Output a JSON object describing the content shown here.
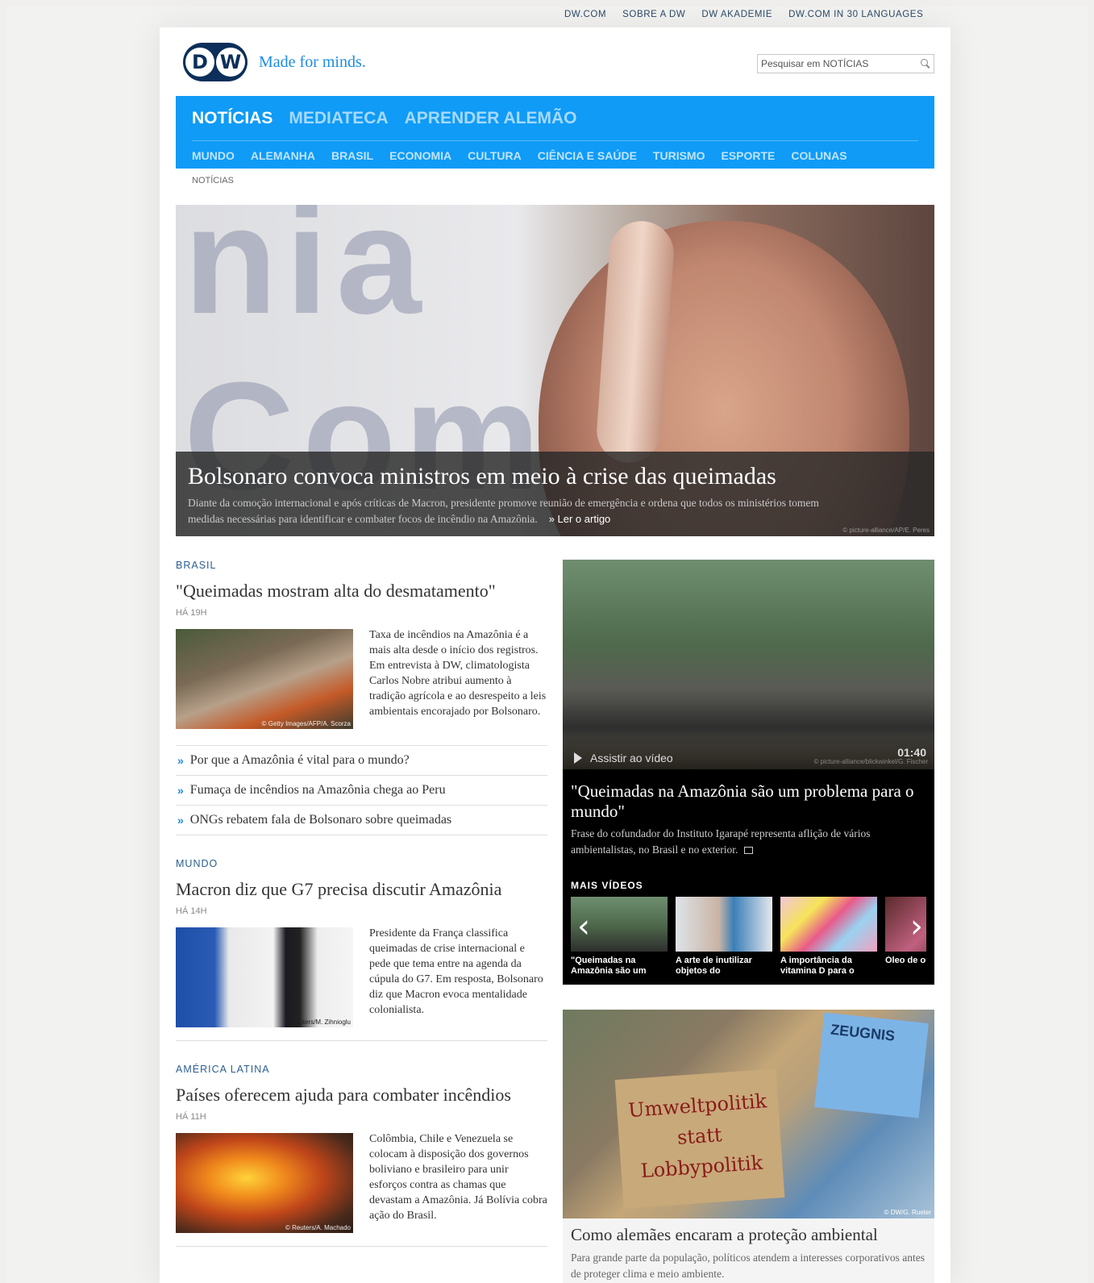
{
  "top_links": [
    "DW.COM",
    "SOBRE A DW",
    "DW AKADEMIE",
    "DW.COM IN 30 LANGUAGES"
  ],
  "brand": {
    "logo_text": "DW",
    "tagline": "Made for minds."
  },
  "search": {
    "placeholder": "Pesquisar em NOTÍCIAS"
  },
  "main_nav": [
    "NOTÍCIAS",
    "MEDIATECA",
    "APRENDER ALEMÃO"
  ],
  "sub_nav": [
    "MUNDO",
    "ALEMANHA",
    "BRASIL",
    "ECONOMIA",
    "CULTURA",
    "CIÊNCIA E SAÚDE",
    "TURISMO",
    "ESPORTE",
    "COLUNAS"
  ],
  "breadcrumb": "NOTÍCIAS",
  "hero": {
    "title": "Bolsonaro convoca ministros em meio à crise das queimadas",
    "text": "Diante da comoção internacional e após críticas de Macron, presidente promove reunião de emergência e ordena que todos os ministérios tomem medidas necessárias para identificar e combater focos de incêndio na Amazônia.",
    "link": "» Ler o artigo",
    "credit": "© picture-alliance/AP/E. Peres"
  },
  "articles": [
    {
      "section": "BRASIL",
      "title": "\"Queimadas mostram alta do desmatamento\"",
      "time": "HÁ 19H",
      "text": "Taxa de incêndios na Amazônia é a mais alta desde o início dos registros. Em entrevista à DW, climatologista Carlos Nobre atribui aumento à tradição agrícola e ao desrespeito a leis ambientais encorajado por Bolsonaro.",
      "credit": "© Getty Images/AFP/A. Scorza"
    },
    {
      "section": "MUNDO",
      "title": "Macron diz que G7 precisa discutir Amazônia",
      "time": "HÁ 14H",
      "text": "Presidente da França classifica queimadas de crise internacional e pede que tema entre na agenda da cúpula do G7. Em resposta, Bolsonaro diz que Macron evoca mentalidade colonialista.",
      "credit": "© Reuters/M. Zihnioglu"
    },
    {
      "section": "AMÉRICA LATINA",
      "title": "Países oferecem ajuda para combater incêndios",
      "time": "HÁ 11H",
      "text": "Colômbia, Chile e Venezuela se colocam à disposição dos governos boliviano e brasileiro para unir esforços contra as chamas que devastam a Amazônia. Já Bolívia cobra ação do Brasil.",
      "credit": "© Reuters/A. Machado"
    }
  ],
  "related_links": [
    "Por que a Amazônia é vital para o mundo?",
    "Fumaça de incêndios na Amazônia chega ao Peru",
    "ONGs rebatem fala de Bolsonaro sobre queimadas"
  ],
  "video": {
    "play_label": "Assistir ao vídeo",
    "duration": "01:40",
    "credit": "© picture-alliance/blickwinkel/G. Fischer",
    "title": "\"Queimadas na Amazônia são um problema para o mundo\"",
    "desc": "Frase do cofundador do Instituto Igarapé representa aflição de vários ambientalistas, no Brasil e no exterior.",
    "more_label": "MAIS VÍDEOS",
    "carousel": [
      "\"Queimadas na Amazônia são um",
      "A arte de inutilizar objetos do",
      "A importância da vitamina D para o",
      "Óleo de ouro pe"
    ]
  },
  "feature": {
    "title": "Como alemães encaram a proteção ambiental",
    "text": "Para grande parte da população, políticos atendem a interesses corporativos antes de proteger clima e meio ambiente.",
    "credit": "© DW/G. Rueter",
    "sign_text": "Umweltpolitik statt Lobbypolitik",
    "sign2_text": "ZEUGNIS"
  },
  "colors": {
    "nav_blue": "#0f9bf6",
    "dw_navy": "#0b2f5a",
    "link_blue": "#1a8ce6"
  }
}
